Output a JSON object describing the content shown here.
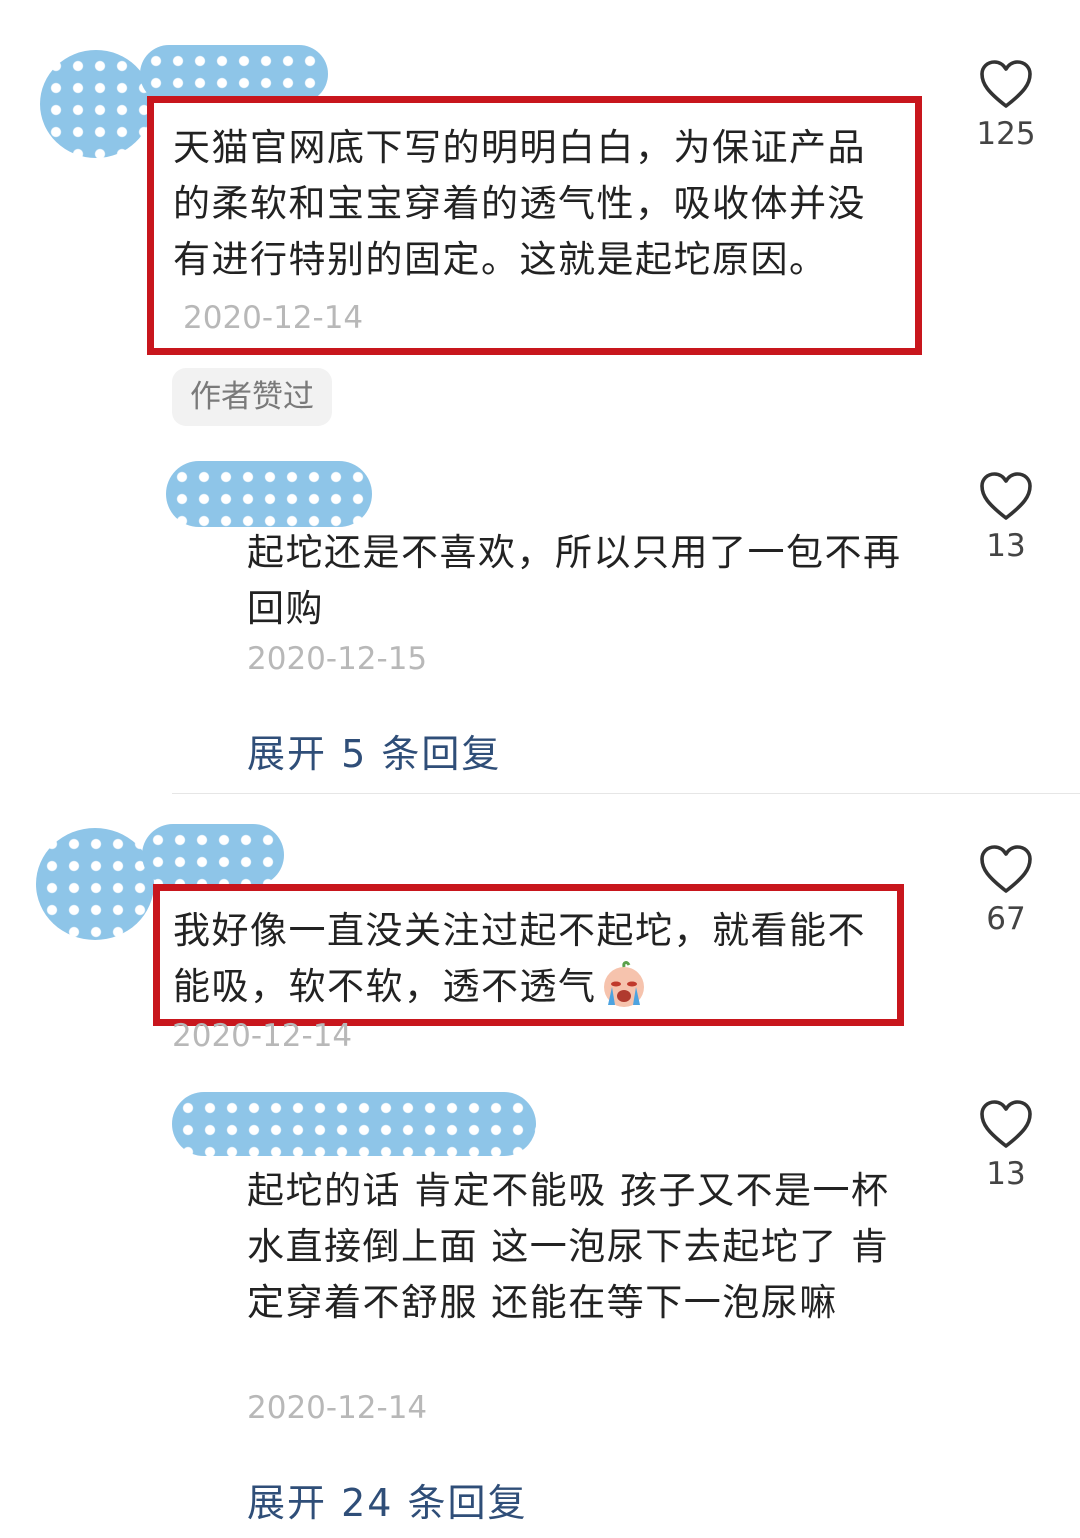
{
  "comments": [
    {
      "text": "天猫官网底下写的明明白白，为保证产品的柔软和宝宝穿着的透气性，吸收体并没有进行特别的固定。这就是起坨原因。",
      "date": "2020-12-14",
      "likes": "125",
      "badge": "作者赞过",
      "reply": {
        "text": "起坨还是不喜欢，所以只用了一包不再回购",
        "date": "2020-12-15",
        "likes": "13"
      },
      "expand_label": "展开 5 条回复"
    },
    {
      "text": "我好像一直没关注过起不起坨，就看能不能吸，软不软，透不透气",
      "emoji": "crying-face-emoji",
      "date": "2020-12-14",
      "likes": "67",
      "reply": {
        "text": "起坨的话 肯定不能吸 孩子又不是一杯水直接倒上面 这一泡尿下去起坨了 肯定穿着不舒服 还能在等下一泡尿嘛",
        "date": "2020-12-14",
        "likes": "13"
      },
      "expand_label": "展开 24 条回复"
    }
  ],
  "colors": {
    "highlight": "#c8161d",
    "link": "#2f4e78",
    "censor": "#8ec5e8",
    "date": "#b8b8b8"
  },
  "icons": {
    "like": "heart-outline-icon"
  }
}
